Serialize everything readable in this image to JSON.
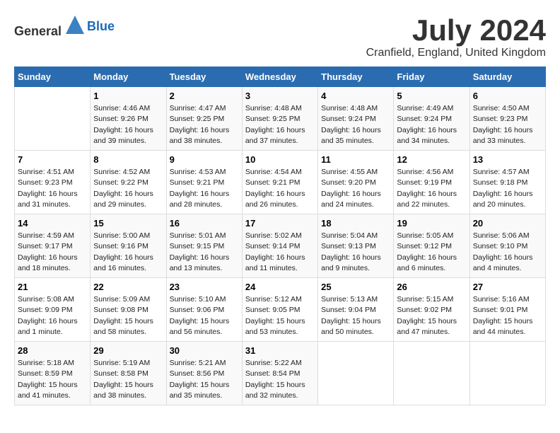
{
  "header": {
    "logo_general": "General",
    "logo_blue": "Blue",
    "title": "July 2024",
    "location": "Cranfield, England, United Kingdom"
  },
  "weekdays": [
    "Sunday",
    "Monday",
    "Tuesday",
    "Wednesday",
    "Thursday",
    "Friday",
    "Saturday"
  ],
  "weeks": [
    [
      {
        "day": "",
        "info": ""
      },
      {
        "day": "1",
        "info": "Sunrise: 4:46 AM\nSunset: 9:26 PM\nDaylight: 16 hours\nand 39 minutes."
      },
      {
        "day": "2",
        "info": "Sunrise: 4:47 AM\nSunset: 9:25 PM\nDaylight: 16 hours\nand 38 minutes."
      },
      {
        "day": "3",
        "info": "Sunrise: 4:48 AM\nSunset: 9:25 PM\nDaylight: 16 hours\nand 37 minutes."
      },
      {
        "day": "4",
        "info": "Sunrise: 4:48 AM\nSunset: 9:24 PM\nDaylight: 16 hours\nand 35 minutes."
      },
      {
        "day": "5",
        "info": "Sunrise: 4:49 AM\nSunset: 9:24 PM\nDaylight: 16 hours\nand 34 minutes."
      },
      {
        "day": "6",
        "info": "Sunrise: 4:50 AM\nSunset: 9:23 PM\nDaylight: 16 hours\nand 33 minutes."
      }
    ],
    [
      {
        "day": "7",
        "info": "Sunrise: 4:51 AM\nSunset: 9:23 PM\nDaylight: 16 hours\nand 31 minutes."
      },
      {
        "day": "8",
        "info": "Sunrise: 4:52 AM\nSunset: 9:22 PM\nDaylight: 16 hours\nand 29 minutes."
      },
      {
        "day": "9",
        "info": "Sunrise: 4:53 AM\nSunset: 9:21 PM\nDaylight: 16 hours\nand 28 minutes."
      },
      {
        "day": "10",
        "info": "Sunrise: 4:54 AM\nSunset: 9:21 PM\nDaylight: 16 hours\nand 26 minutes."
      },
      {
        "day": "11",
        "info": "Sunrise: 4:55 AM\nSunset: 9:20 PM\nDaylight: 16 hours\nand 24 minutes."
      },
      {
        "day": "12",
        "info": "Sunrise: 4:56 AM\nSunset: 9:19 PM\nDaylight: 16 hours\nand 22 minutes."
      },
      {
        "day": "13",
        "info": "Sunrise: 4:57 AM\nSunset: 9:18 PM\nDaylight: 16 hours\nand 20 minutes."
      }
    ],
    [
      {
        "day": "14",
        "info": "Sunrise: 4:59 AM\nSunset: 9:17 PM\nDaylight: 16 hours\nand 18 minutes."
      },
      {
        "day": "15",
        "info": "Sunrise: 5:00 AM\nSunset: 9:16 PM\nDaylight: 16 hours\nand 16 minutes."
      },
      {
        "day": "16",
        "info": "Sunrise: 5:01 AM\nSunset: 9:15 PM\nDaylight: 16 hours\nand 13 minutes."
      },
      {
        "day": "17",
        "info": "Sunrise: 5:02 AM\nSunset: 9:14 PM\nDaylight: 16 hours\nand 11 minutes."
      },
      {
        "day": "18",
        "info": "Sunrise: 5:04 AM\nSunset: 9:13 PM\nDaylight: 16 hours\nand 9 minutes."
      },
      {
        "day": "19",
        "info": "Sunrise: 5:05 AM\nSunset: 9:12 PM\nDaylight: 16 hours\nand 6 minutes."
      },
      {
        "day": "20",
        "info": "Sunrise: 5:06 AM\nSunset: 9:10 PM\nDaylight: 16 hours\nand 4 minutes."
      }
    ],
    [
      {
        "day": "21",
        "info": "Sunrise: 5:08 AM\nSunset: 9:09 PM\nDaylight: 16 hours\nand 1 minute."
      },
      {
        "day": "22",
        "info": "Sunrise: 5:09 AM\nSunset: 9:08 PM\nDaylight: 15 hours\nand 58 minutes."
      },
      {
        "day": "23",
        "info": "Sunrise: 5:10 AM\nSunset: 9:06 PM\nDaylight: 15 hours\nand 56 minutes."
      },
      {
        "day": "24",
        "info": "Sunrise: 5:12 AM\nSunset: 9:05 PM\nDaylight: 15 hours\nand 53 minutes."
      },
      {
        "day": "25",
        "info": "Sunrise: 5:13 AM\nSunset: 9:04 PM\nDaylight: 15 hours\nand 50 minutes."
      },
      {
        "day": "26",
        "info": "Sunrise: 5:15 AM\nSunset: 9:02 PM\nDaylight: 15 hours\nand 47 minutes."
      },
      {
        "day": "27",
        "info": "Sunrise: 5:16 AM\nSunset: 9:01 PM\nDaylight: 15 hours\nand 44 minutes."
      }
    ],
    [
      {
        "day": "28",
        "info": "Sunrise: 5:18 AM\nSunset: 8:59 PM\nDaylight: 15 hours\nand 41 minutes."
      },
      {
        "day": "29",
        "info": "Sunrise: 5:19 AM\nSunset: 8:58 PM\nDaylight: 15 hours\nand 38 minutes."
      },
      {
        "day": "30",
        "info": "Sunrise: 5:21 AM\nSunset: 8:56 PM\nDaylight: 15 hours\nand 35 minutes."
      },
      {
        "day": "31",
        "info": "Sunrise: 5:22 AM\nSunset: 8:54 PM\nDaylight: 15 hours\nand 32 minutes."
      },
      {
        "day": "",
        "info": ""
      },
      {
        "day": "",
        "info": ""
      },
      {
        "day": "",
        "info": ""
      }
    ]
  ]
}
